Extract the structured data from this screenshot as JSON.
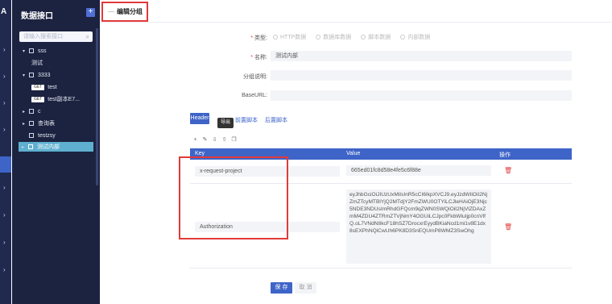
{
  "rail": {
    "logo": "A"
  },
  "sidebar": {
    "title": "数据接口",
    "add_label": "+",
    "search_placeholder": "请输入搜索接口",
    "items": [
      {
        "label": "sss"
      },
      {
        "label": "测试"
      },
      {
        "label": "3333"
      },
      {
        "method": "GET",
        "label": "test"
      },
      {
        "method": "GET",
        "label": "test副本E7..."
      },
      {
        "label": "c"
      },
      {
        "label": "查询表"
      },
      {
        "label": "testzsy"
      },
      {
        "label": "测试内部"
      }
    ]
  },
  "header": {
    "dash": "—",
    "title": "编辑分组"
  },
  "form": {
    "type_label": "类型:",
    "type_options": [
      "HTTP数据",
      "数据库数据",
      "脚本数据",
      "内部数据"
    ],
    "name_label": "名称:",
    "name_value": "测试内部",
    "desc_label": "分组说明:",
    "desc_value": "",
    "baseurl_label": "BaseURL:",
    "baseurl_value": ""
  },
  "tabs": {
    "header": "Header",
    "pre": "前置脚本",
    "post": "后置脚本"
  },
  "tooltip": "导出",
  "toolbar_icons": [
    "plus-icon",
    "edit-icon",
    "import-icon",
    "export-icon",
    "copy-icon"
  ],
  "table": {
    "headers": {
      "key": "Key",
      "value": "Value",
      "action": "操作"
    },
    "rows": [
      {
        "key": "x-request-project",
        "value": "665ed01fc8d58e4fe5c6f88e"
      },
      {
        "key": "Authorization",
        "value": "eyJhbGciOiJIUzUxMiIsInR5cCI6IkpXVCJ9.eyJzdWIiOiI2NjZmZTcyMTBlYjQ2MTdjY2FmZWU0OTYiLCJleHAiOjE3Njc5NDE3NDUsImRhdGFQcm9qZWN0SWQiOiI2NjVlZDAxZmM4ZDU4ZTRmZTVjNmY4OGUiLCJpc0FkbWluIjp0cnVlfQ.oL7VNdN8kcF18hSZ7DrocxrEyydBKiaNcd1mi1v8E1dx8sEXPhNQiCwUh6PK8D3SnEQUmP8WMZ3SwOhg"
      }
    ]
  },
  "buttons": {
    "save": "保 存",
    "cancel": "取 消"
  }
}
